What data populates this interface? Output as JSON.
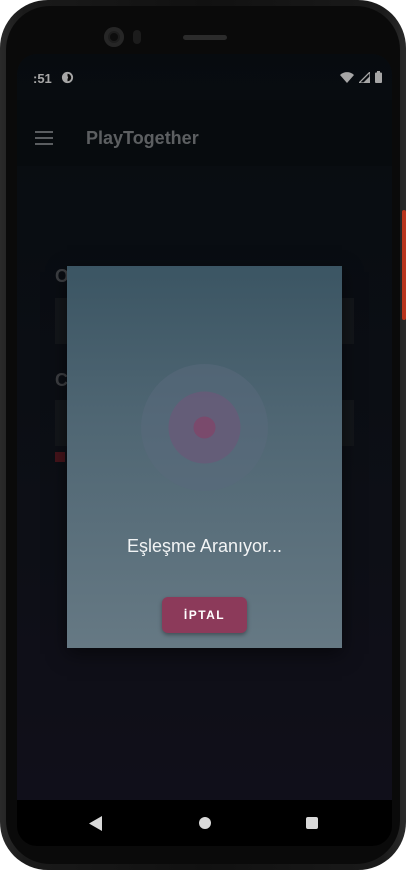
{
  "status_bar": {
    "time": ":51",
    "icons": [
      "app-notification-icon",
      "wifi-icon",
      "signal-icon",
      "battery-icon"
    ]
  },
  "app_bar": {
    "title": "PlayTogether",
    "menu_icon": "hamburger-menu-icon"
  },
  "form": {
    "field1_label": "O",
    "field2_label": "C"
  },
  "dialog": {
    "message": "Eşleşme Aranıyor...",
    "cancel_label": "İPTAL",
    "animation_icon": "radar-search-icon"
  },
  "nav_bar": {
    "back": "back-icon",
    "home": "home-icon",
    "recents": "recents-icon"
  },
  "colors": {
    "dialog_top": "#3b5563",
    "dialog_bottom": "#667984",
    "button": "#8c3a5a",
    "radar_core": "#7a4a6c"
  }
}
